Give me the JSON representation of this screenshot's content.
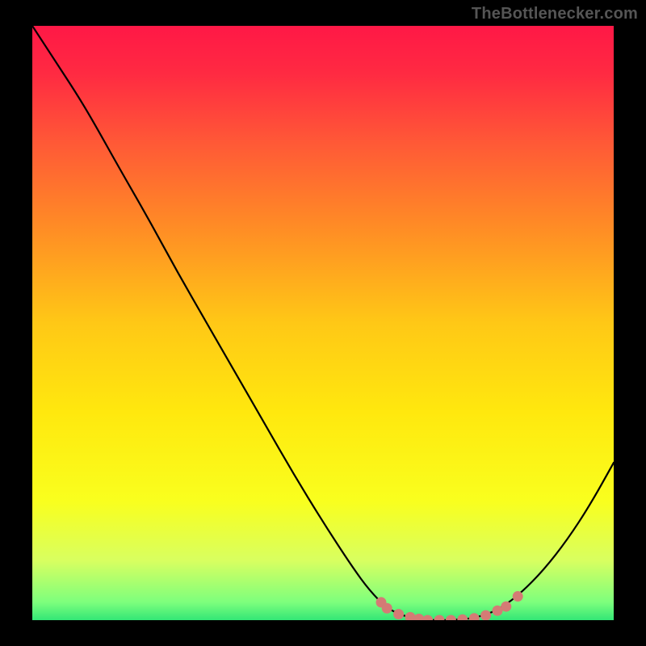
{
  "watermark": "TheBottlenecker.com",
  "chart_data": {
    "type": "line",
    "title": "",
    "xlabel": "",
    "ylabel": "",
    "xlim": [
      0,
      100
    ],
    "ylim": [
      0,
      100
    ],
    "background_gradient": {
      "stops": [
        {
          "offset": 0.0,
          "color": "#ff1846"
        },
        {
          "offset": 0.08,
          "color": "#ff2a42"
        },
        {
          "offset": 0.2,
          "color": "#ff5a36"
        },
        {
          "offset": 0.35,
          "color": "#ff9024"
        },
        {
          "offset": 0.5,
          "color": "#ffc816"
        },
        {
          "offset": 0.65,
          "color": "#ffe80e"
        },
        {
          "offset": 0.8,
          "color": "#f9ff1e"
        },
        {
          "offset": 0.9,
          "color": "#d8ff60"
        },
        {
          "offset": 0.97,
          "color": "#7dff7d"
        },
        {
          "offset": 1.0,
          "color": "#33e676"
        }
      ]
    },
    "series": [
      {
        "name": "bottleneck-curve",
        "color": "#000000",
        "points": [
          {
            "x": 0.0,
            "y": 100.0
          },
          {
            "x": 4.0,
            "y": 94.0
          },
          {
            "x": 8.0,
            "y": 88.0
          },
          {
            "x": 11.0,
            "y": 83.0
          },
          {
            "x": 15.0,
            "y": 76.0
          },
          {
            "x": 20.0,
            "y": 67.5
          },
          {
            "x": 25.0,
            "y": 58.5
          },
          {
            "x": 30.0,
            "y": 50.0
          },
          {
            "x": 35.0,
            "y": 41.5
          },
          {
            "x": 40.0,
            "y": 33.0
          },
          {
            "x": 45.0,
            "y": 24.5
          },
          {
            "x": 50.0,
            "y": 16.5
          },
          {
            "x": 55.0,
            "y": 9.0
          },
          {
            "x": 58.0,
            "y": 5.0
          },
          {
            "x": 61.0,
            "y": 2.0
          },
          {
            "x": 64.0,
            "y": 0.6
          },
          {
            "x": 68.0,
            "y": 0.0
          },
          {
            "x": 72.0,
            "y": 0.0
          },
          {
            "x": 76.0,
            "y": 0.3
          },
          {
            "x": 80.0,
            "y": 1.6
          },
          {
            "x": 84.0,
            "y": 4.5
          },
          {
            "x": 88.0,
            "y": 8.5
          },
          {
            "x": 92.0,
            "y": 13.5
          },
          {
            "x": 96.0,
            "y": 19.5
          },
          {
            "x": 100.0,
            "y": 26.5
          }
        ]
      }
    ],
    "optimal_markers": {
      "name": "optimal-zone",
      "color": "#d47b75",
      "points": [
        {
          "x": 60.0,
          "y": 3.0
        },
        {
          "x": 61.0,
          "y": 2.0
        },
        {
          "x": 63.0,
          "y": 1.0
        },
        {
          "x": 65.0,
          "y": 0.5
        },
        {
          "x": 66.5,
          "y": 0.2
        },
        {
          "x": 68.0,
          "y": 0.0
        },
        {
          "x": 70.0,
          "y": 0.0
        },
        {
          "x": 72.0,
          "y": 0.0
        },
        {
          "x": 74.0,
          "y": 0.1
        },
        {
          "x": 76.0,
          "y": 0.3
        },
        {
          "x": 78.0,
          "y": 0.8
        },
        {
          "x": 80.0,
          "y": 1.6
        },
        {
          "x": 81.5,
          "y": 2.3
        },
        {
          "x": 83.5,
          "y": 4.0
        }
      ]
    }
  }
}
